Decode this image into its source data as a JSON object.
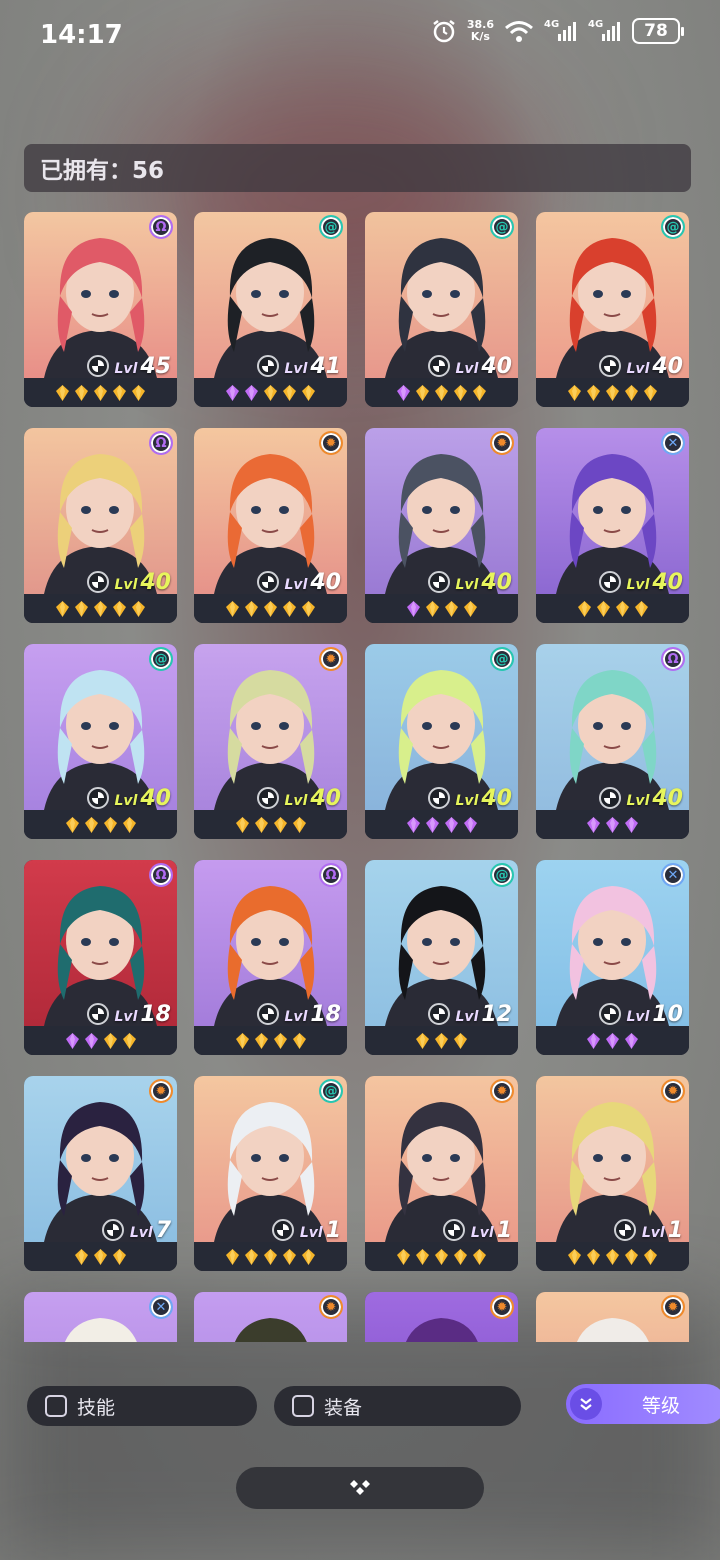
{
  "status_bar": {
    "time": "14:17",
    "net_speed_value": "38.6",
    "net_speed_unit": "K/s",
    "sim1": "4G",
    "sim2": "4G",
    "battery": "78",
    "icons": [
      "alarm-icon",
      "wifi-icon",
      "signal-icon",
      "signal-icon",
      "battery-icon"
    ]
  },
  "header": {
    "owned_label": "已拥有：56"
  },
  "level_prefix": "Lvl",
  "cards": [
    {
      "level": "45",
      "element": "purple-omega",
      "stars": [
        "gold",
        "gold",
        "gold",
        "gold",
        "gold"
      ],
      "gold_level": false,
      "bg": [
        "#f3c7a1",
        "#e88f88"
      ],
      "hair": "#e05a67"
    },
    {
      "level": "41",
      "element": "teal-swirl",
      "stars": [
        "purple",
        "purple",
        "gold",
        "gold",
        "gold"
      ],
      "gold_level": false,
      "bg": [
        "#f3c7a1",
        "#e99a8e"
      ],
      "hair": "#1e2126"
    },
    {
      "level": "40",
      "element": "teal-swirl",
      "stars": [
        "purple",
        "gold",
        "gold",
        "gold",
        "gold"
      ],
      "gold_level": false,
      "bg": [
        "#f1c39d",
        "#e7988c"
      ],
      "hair": "#2f3340"
    },
    {
      "level": "40",
      "element": "teal-swirl",
      "stars": [
        "gold",
        "gold",
        "gold",
        "gold",
        "gold"
      ],
      "gold_level": false,
      "bg": [
        "#f4c6a0",
        "#ec9d8c"
      ],
      "hair": "#d9402d"
    },
    {
      "level": "40",
      "element": "purple-omega",
      "stars": [
        "gold",
        "gold",
        "gold",
        "gold",
        "gold"
      ],
      "gold_level": true,
      "bg": [
        "#f3c59f",
        "#e2988c"
      ],
      "hair": "#ecd07a"
    },
    {
      "level": "40",
      "element": "orange-gear",
      "stars": [
        "gold",
        "gold",
        "gold",
        "gold",
        "gold"
      ],
      "gold_level": false,
      "bg": [
        "#f4c79f",
        "#e6938a"
      ],
      "hair": "#ea6a35"
    },
    {
      "level": "40",
      "element": "orange-gear",
      "stars": [
        "purple",
        "gold",
        "gold",
        "gold"
      ],
      "gold_level": true,
      "bg": [
        "#bba0e8",
        "#9a7ad4"
      ],
      "hair": "#4b5262"
    },
    {
      "level": "40",
      "element": "blue-cross",
      "stars": [
        "gold",
        "gold",
        "gold",
        "gold"
      ],
      "gold_level": true,
      "bg": [
        "#b68fe9",
        "#8d69d2"
      ],
      "hair": "#6c47c4"
    },
    {
      "level": "40",
      "element": "teal-swirl",
      "stars": [
        "gold",
        "gold",
        "gold",
        "gold"
      ],
      "gold_level": true,
      "bg": [
        "#c69ff0",
        "#a783e0"
      ],
      "hair": "#bfe3f2"
    },
    {
      "level": "40",
      "element": "orange-gear",
      "stars": [
        "gold",
        "gold",
        "gold",
        "gold"
      ],
      "gold_level": true,
      "bg": [
        "#c7a3ee",
        "#a985dd"
      ],
      "hair": "#d6dba0"
    },
    {
      "level": "40",
      "element": "teal-swirl",
      "stars": [
        "purple",
        "purple",
        "purple",
        "purple"
      ],
      "gold_level": true,
      "bg": [
        "#9bcbe8",
        "#8ab4dc"
      ],
      "hair": "#d8ef8c"
    },
    {
      "level": "40",
      "element": "purple-omega",
      "stars": [
        "purple",
        "purple",
        "purple"
      ],
      "gold_level": true,
      "bg": [
        "#a8d1ea",
        "#93bde0"
      ],
      "hair": "#7fd6c7"
    },
    {
      "level": "18",
      "element": "purple-omega",
      "stars": [
        "purple",
        "purple",
        "gold",
        "gold"
      ],
      "gold_level": false,
      "bg": [
        "#d23b4b",
        "#b22a3a"
      ],
      "hair": "#1f6c6e"
    },
    {
      "level": "18",
      "element": "purple-omega",
      "stars": [
        "gold",
        "gold",
        "gold",
        "gold"
      ],
      "gold_level": false,
      "bg": [
        "#c59bef",
        "#a47ddb"
      ],
      "hair": "#e96c2d"
    },
    {
      "level": "12",
      "element": "teal-swirl",
      "stars": [
        "gold",
        "gold",
        "gold"
      ],
      "gold_level": false,
      "bg": [
        "#a5d3ec",
        "#8fc0e2"
      ],
      "hair": "#141519"
    },
    {
      "level": "10",
      "element": "blue-cross",
      "stars": [
        "purple",
        "purple",
        "purple"
      ],
      "gold_level": false,
      "bg": [
        "#9dd3f0",
        "#84bfe6"
      ],
      "hair": "#f2c2e0"
    },
    {
      "level": "7",
      "element": "orange-gear",
      "stars": [
        "gold",
        "gold",
        "gold"
      ],
      "gold_level": false,
      "bg": [
        "#a8d3ec",
        "#8dbfe2"
      ],
      "hair": "#2a2240"
    },
    {
      "level": "1",
      "element": "teal-swirl",
      "stars": [
        "gold",
        "gold",
        "gold",
        "gold",
        "gold"
      ],
      "gold_level": false,
      "bg": [
        "#f4c7a0",
        "#e99b8c"
      ],
      "hair": "#eceff3"
    },
    {
      "level": "1",
      "element": "orange-gear",
      "stars": [
        "gold",
        "gold",
        "gold",
        "gold",
        "gold"
      ],
      "gold_level": false,
      "bg": [
        "#f4c5a0",
        "#ea9b8a"
      ],
      "hair": "#343240"
    },
    {
      "level": "1",
      "element": "orange-gear",
      "stars": [
        "gold",
        "gold",
        "gold",
        "gold",
        "gold"
      ],
      "gold_level": false,
      "bg": [
        "#f3c69f",
        "#e7998a"
      ],
      "hair": "#e7d77a"
    },
    {
      "level": "",
      "element": "blue-cross",
      "stars": [],
      "gold_level": false,
      "bg": [
        "#c69ff0",
        "#a784de"
      ],
      "hair": "#f2eee6"
    },
    {
      "level": "",
      "element": "orange-gear",
      "stars": [],
      "gold_level": false,
      "bg": [
        "#c49df0",
        "#a583de"
      ],
      "hair": "#3b3d2c"
    },
    {
      "level": "",
      "element": "orange-gear",
      "stars": [],
      "gold_level": false,
      "bg": [
        "#9f6be0",
        "#7b4dc8"
      ],
      "hair": "#5a2c84"
    },
    {
      "level": "",
      "element": "orange-gear",
      "stars": [],
      "gold_level": false,
      "bg": [
        "#f4c7a0",
        "#e89b8c"
      ],
      "hair": "#f0ece8"
    }
  ],
  "footer": {
    "skill_filter_label": "技能",
    "equip_filter_label": "装备",
    "sort_label": "等级",
    "sort_icon": "chevron-double-down-icon",
    "handle_icon": "diamond-cluster-icon"
  },
  "colors": {
    "gold_gem": "#f5b52a",
    "purple_gem": "#c06cf5",
    "level_gold": "#e7f55c",
    "sort_button": "#8a6cff"
  }
}
